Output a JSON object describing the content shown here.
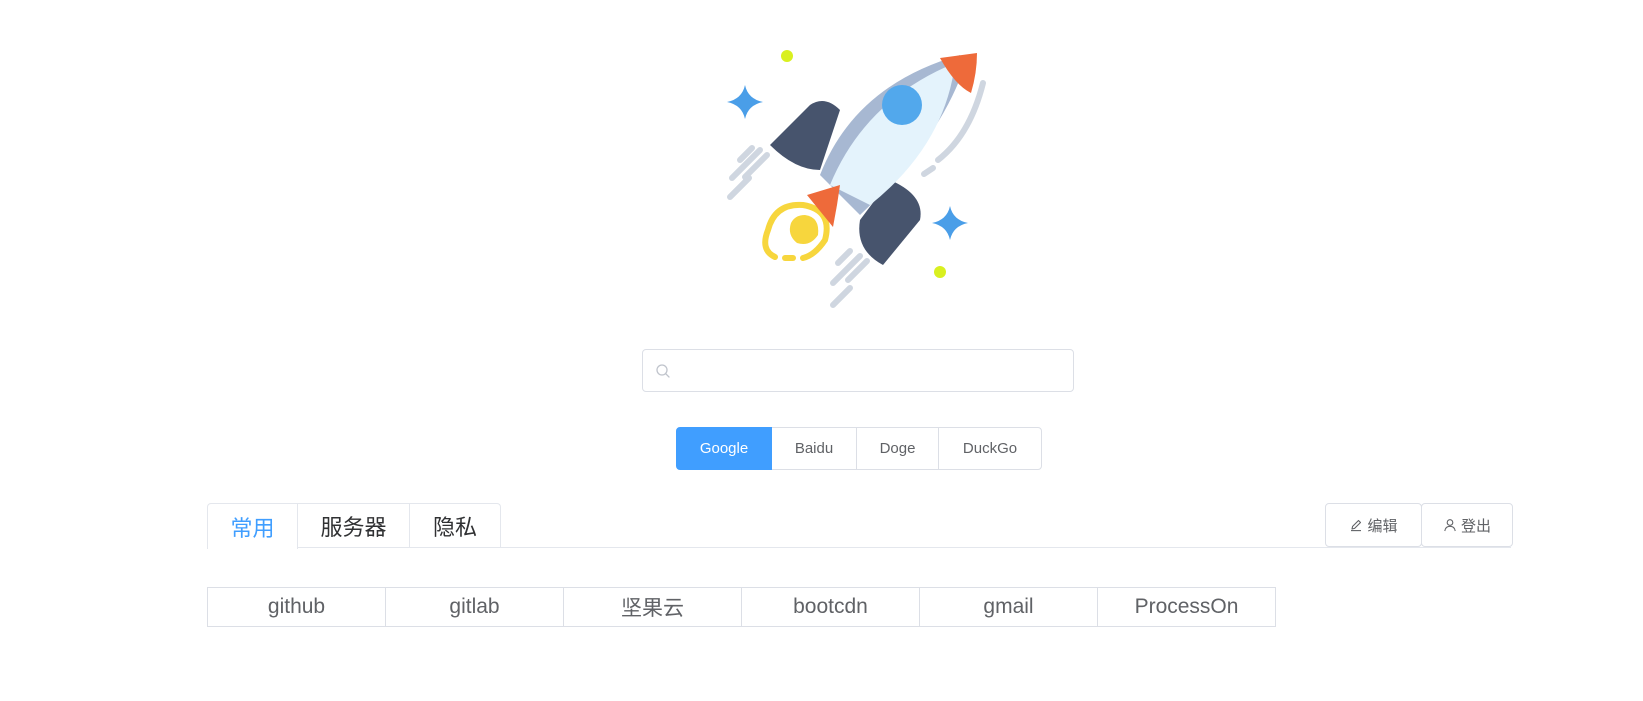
{
  "search": {
    "value": "",
    "placeholder": ""
  },
  "engines": [
    {
      "label": "Google",
      "active": true
    },
    {
      "label": "Baidu",
      "active": false
    },
    {
      "label": "Doge",
      "active": false
    },
    {
      "label": "DuckGo",
      "active": false
    }
  ],
  "tabs": [
    {
      "label": "常用",
      "active": true
    },
    {
      "label": "服务器",
      "active": false
    },
    {
      "label": "隐私",
      "active": false
    }
  ],
  "actions": {
    "edit_label": "编辑",
    "logout_label": "登出"
  },
  "links": [
    "github",
    "gitlab",
    "坚果云",
    "bootcdn",
    "gmail",
    "ProcessOn"
  ],
  "colors": {
    "accent": "#409eff",
    "border": "#dcdfe6",
    "text": "#606266"
  }
}
